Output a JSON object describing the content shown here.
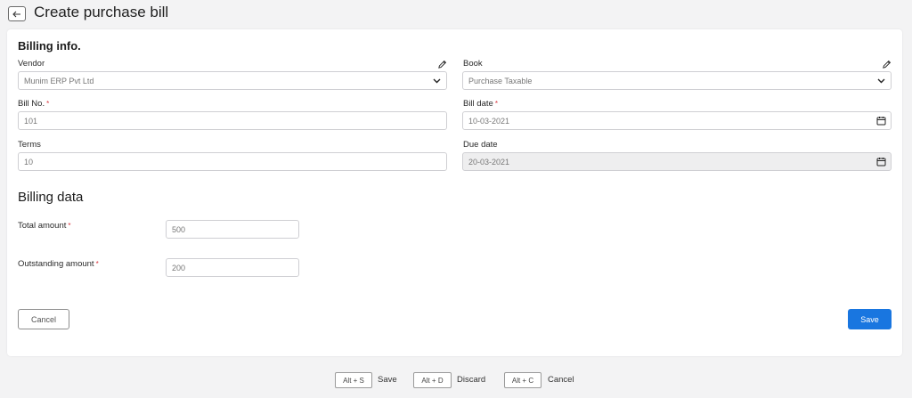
{
  "header": {
    "title": "Create purchase bill",
    "back_icon": "arrow-left-icon"
  },
  "billing_info": {
    "title": "Billing info.",
    "vendor": {
      "label": "Vendor",
      "value": "Munim ERP Pvt Ltd"
    },
    "book": {
      "label": "Book",
      "value": "Purchase Taxable"
    },
    "bill_no": {
      "label": "Bill No.",
      "required_mark": "*",
      "value": "101"
    },
    "bill_date": {
      "label": "Bill date",
      "required_mark": "*",
      "value": "10-03-2021"
    },
    "terms": {
      "label": "Terms",
      "value": "10"
    },
    "due_date": {
      "label": "Due date",
      "value": "20-03-2021"
    }
  },
  "billing_data": {
    "title": "Billing data",
    "total_amount": {
      "label": "Total amount",
      "required_mark": "*",
      "value": "500"
    },
    "outstanding_amount": {
      "label": "Outstanding amount",
      "required_mark": "*",
      "value": "200"
    }
  },
  "actions": {
    "cancel_label": "Cancel",
    "save_label": "Save"
  },
  "shortcuts": [
    {
      "key": "Alt + S",
      "label": "Save"
    },
    {
      "key": "Alt + D",
      "label": "Discard"
    },
    {
      "key": "Alt + C",
      "label": "Cancel"
    }
  ],
  "colors": {
    "primary": "#1976e0",
    "required": "#d9363e",
    "background": "#f3f3f4"
  }
}
